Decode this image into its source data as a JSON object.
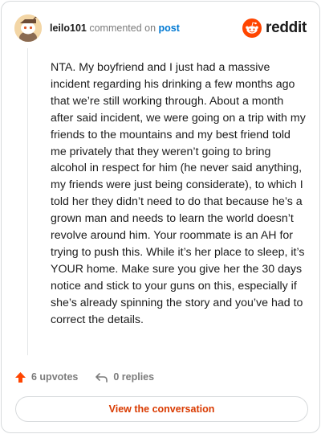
{
  "header": {
    "username": "leilo101",
    "action_text": "commented on",
    "post_link": "post",
    "brand": "reddit",
    "avatar_icon": "snoo-avatar-icon",
    "brand_icon": "reddit-snoo-icon",
    "brand_color": "#ff4500"
  },
  "comment": {
    "text": "NTA. My boyfriend and I just had a massive incident regarding his drinking a few months ago that we’re still working through. About a month after said incident, we were going on a trip with my friends to the mountains and my best friend told me privately that they weren’t going to bring alcohol in respect for him (he never said anything, my friends were just being considerate), to which I told her they didn’t need to do that because he’s a grown man and needs to learn the world doesn’t revolve around him. Your roommate is an AH for trying to push this. While it’s her place to sleep, it’s YOUR home. Make sure you give her the 30 days notice and stick to your guns on this, especially if she’s already spinning the story and you’ve had to correct the details."
  },
  "actions": {
    "upvotes": "6 upvotes",
    "replies": "0 replies",
    "upvote_icon": "upvote-arrow-icon",
    "reply_icon": "reply-arrow-icon",
    "upvote_color": "#ff4500"
  },
  "cta": {
    "label": "View the conversation",
    "color": "#d93a00"
  }
}
